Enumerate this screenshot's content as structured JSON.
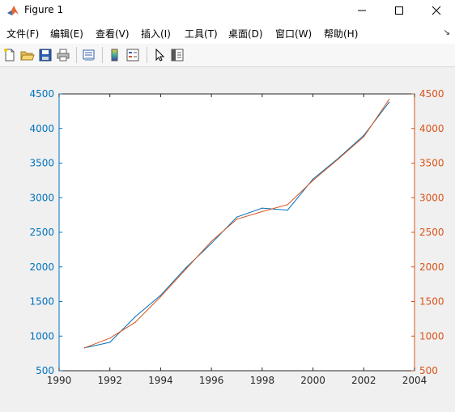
{
  "window": {
    "title": "Figure 1"
  },
  "menu": {
    "items": [
      "文件(F)",
      "编辑(E)",
      "查看(V)",
      "插入(I)",
      "工具(T)",
      "桌面(D)",
      "窗口(W)",
      "帮助(H)"
    ]
  },
  "toolbar": {
    "icons": [
      "new-file-icon",
      "open-folder-icon",
      "save-icon",
      "print-icon",
      "print-preview-icon",
      "colorbar-icon",
      "legend-icon",
      "pointer-icon",
      "property-editor-icon"
    ]
  },
  "colors": {
    "left_series": "#0072bd",
    "right_series": "#d95319",
    "axis_text": "#262626"
  },
  "chart_data": {
    "type": "line",
    "xlim": [
      1990,
      2004
    ],
    "x_ticks": [
      "1990",
      "1992",
      "1994",
      "1996",
      "1998",
      "2000",
      "2002",
      "2004"
    ],
    "ylim_left": [
      500,
      4500
    ],
    "ylim_right": [
      500,
      4500
    ],
    "y_ticks_left": [
      "500",
      "1000",
      "1500",
      "2000",
      "2500",
      "3000",
      "3500",
      "4000",
      "4500"
    ],
    "y_ticks_right": [
      "500",
      "1000",
      "1500",
      "2000",
      "2500",
      "3000",
      "3500",
      "4000",
      "4500"
    ],
    "series": [
      {
        "axis": "left",
        "x": [
          1991,
          1992,
          1993,
          1994,
          1995,
          1996,
          1997,
          1998,
          1999,
          2000,
          2001,
          2002,
          2003
        ],
        "y": [
          830,
          910,
          1280,
          1590,
          1990,
          2340,
          2720,
          2850,
          2820,
          3270,
          3570,
          3900,
          4380
        ]
      },
      {
        "axis": "right",
        "x": [
          1991,
          1992,
          1993,
          1994,
          1995,
          1996,
          1997,
          1998,
          1999,
          2000,
          2001,
          2002,
          2003
        ],
        "y": [
          830,
          970,
          1200,
          1570,
          1970,
          2370,
          2690,
          2800,
          2900,
          3250,
          3560,
          3880,
          4420
        ]
      }
    ]
  }
}
